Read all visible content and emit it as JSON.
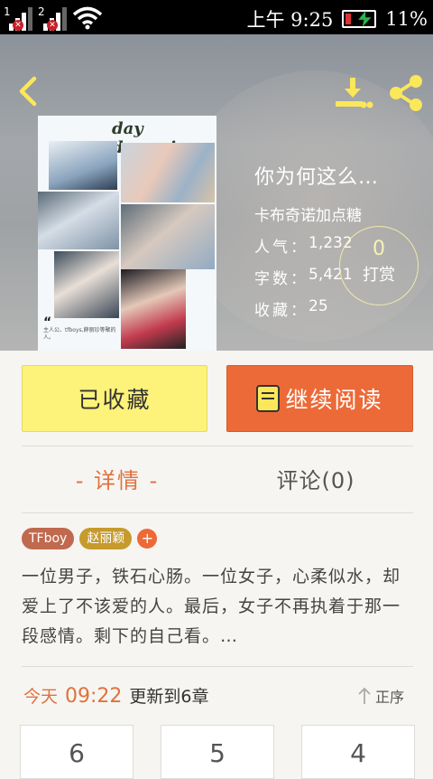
{
  "status_bar": {
    "sim1": "1",
    "sim2": "2",
    "time": "上午 9:25",
    "battery": "11%"
  },
  "cover": {
    "title": "day dreaming",
    "quote": "主人公、tfboys,薛丽珍等聚的人。"
  },
  "book": {
    "title": "你为何这么…",
    "author": "卡布奇诺加点糖",
    "popularity_label": "人气：",
    "popularity": "1,232",
    "words_label": "字数：",
    "words": "5,421",
    "favorites_label": "收藏：",
    "favorites": "25"
  },
  "tip": {
    "count": "0",
    "label": "打赏"
  },
  "actions": {
    "collected_label": "已收藏",
    "continue_label": "继续阅读"
  },
  "tabs": {
    "detail": "- 详情 -",
    "comments": "评论(0)"
  },
  "tags": [
    "TFboy",
    "赵丽颖"
  ],
  "tag_add": "+",
  "synopsis": "一位男子，铁石心肠。一位女子，心柔似水，却爱上了不该爱的人。最后，女子不再执着于那一段感情。剩下的自己看。…",
  "update": {
    "today": "今天",
    "time": "09:22",
    "text": "更新到6章"
  },
  "order_label": "正序",
  "chapters": [
    "6",
    "5",
    "4"
  ],
  "colors": {
    "accent": "#ec6a37",
    "collected": "#fdf27a",
    "tag1": "#c0694e",
    "tag2": "#c69a2c"
  }
}
